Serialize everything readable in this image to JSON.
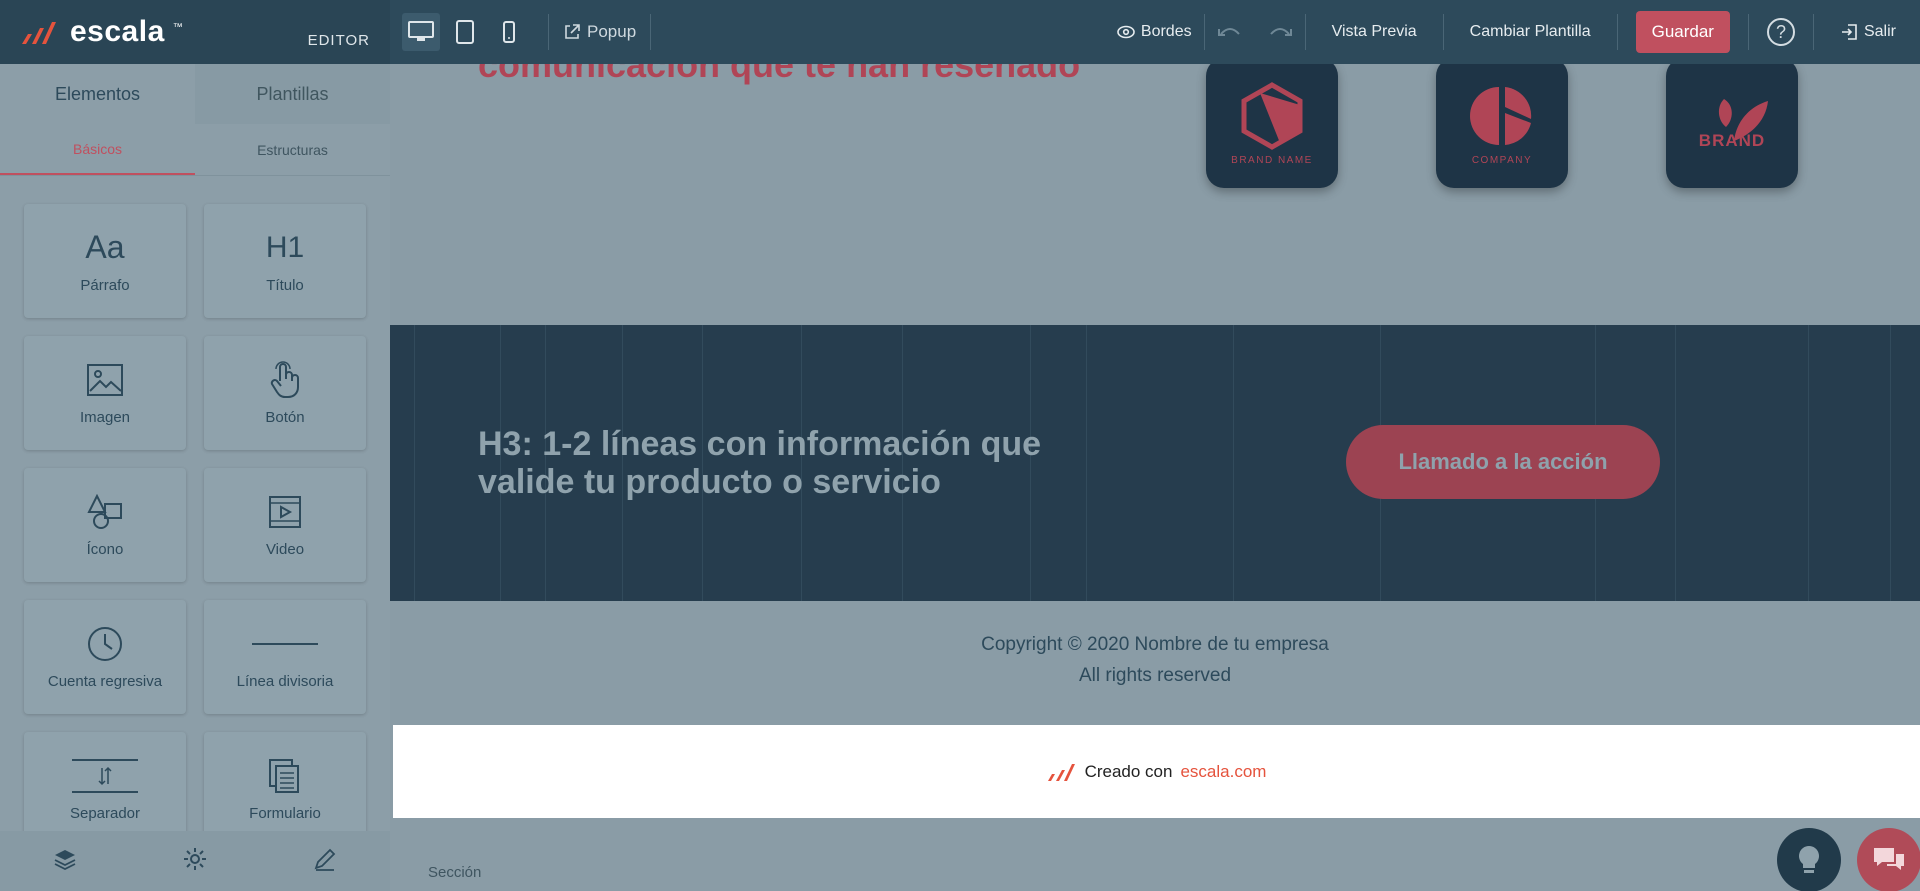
{
  "topbar": {
    "brand": "escala",
    "brand_tm": "™",
    "editor_label": "EDITOR",
    "popup_label": "Popup",
    "bordes_label": "Bordes",
    "preview_label": "Vista Previa",
    "change_template_label": "Cambiar Plantilla",
    "save_label": "Guardar",
    "help_label": "?",
    "exit_label": "Salir"
  },
  "sidebar": {
    "tabs": [
      {
        "label": "Elementos"
      },
      {
        "label": "Plantillas"
      }
    ],
    "subtabs": [
      {
        "label": "Básicos"
      },
      {
        "label": "Estructuras"
      }
    ],
    "elements": [
      {
        "label": "Párrafo",
        "icon": "Aa"
      },
      {
        "label": "Título",
        "icon": "H1"
      },
      {
        "label": "Imagen",
        "icon": "image-icon"
      },
      {
        "label": "Botón",
        "icon": "pointer-hand-icon"
      },
      {
        "label": "Ícono",
        "icon": "shapes-icon"
      },
      {
        "label": "Video",
        "icon": "video-icon"
      },
      {
        "label": "Cuenta regresiva",
        "icon": "clock-icon"
      },
      {
        "label": "Línea divisoria",
        "icon": "line-icon"
      },
      {
        "label": "Separador",
        "icon": "separator-icon"
      },
      {
        "label": "Formulario",
        "icon": "form-icon"
      }
    ]
  },
  "canvas": {
    "hero_text": "comunicación que te han reseñado",
    "logos": [
      {
        "caption": "BRAND NAME"
      },
      {
        "caption": "COMPANY"
      },
      {
        "caption": "BRAND"
      }
    ],
    "cta_title": "H3: 1-2 líneas con información que valide tu producto o servicio",
    "cta_button": "Llamado a la acción",
    "footer_line1": "Copyright © 2020 Nombre de tu empresa",
    "footer_line2": "All rights reserved",
    "made_with": "Creado con",
    "made_link": "escala.com",
    "section_label": "Sección"
  },
  "colors": {
    "topbar": "#2d4a5b",
    "accent": "#c0505f",
    "cta_bg": "#263d4e",
    "overlay": "#8a9ca6"
  }
}
